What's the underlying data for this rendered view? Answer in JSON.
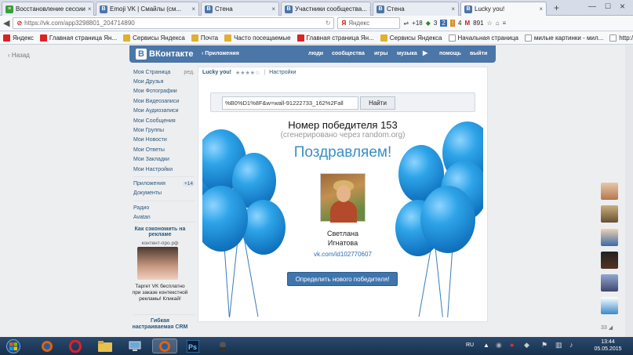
{
  "tabs": [
    {
      "label": "Восстановление сессии",
      "icon": "restore-icon",
      "active": false
    },
    {
      "label": "Emoji VK | Смайлы (см...",
      "icon": "vk-icon",
      "active": false
    },
    {
      "label": "Стена",
      "icon": "vk-icon",
      "active": false
    },
    {
      "label": "Участники сообщества...",
      "icon": "vk-icon",
      "active": false
    },
    {
      "label": "Стена",
      "icon": "vk-icon",
      "active": false
    },
    {
      "label": "Lucky you!",
      "icon": "vk-icon",
      "active": true
    }
  ],
  "address": {
    "url": "https://vk.com/app3298801_204714890",
    "search_engine": "Яндекс",
    "counters": [
      "+18",
      "3",
      "4",
      "891"
    ]
  },
  "bookmarks": [
    "Яндекс",
    "Главная страница Ян...",
    "Сервисы Яндекса",
    "Почта",
    "Часто посещаемые",
    "Главная страница Ян...",
    "Сервисы Яндекса",
    "Начальная страница",
    "милые картинки - мил...",
    "http://photoshop.vse-..."
  ],
  "back_label": "Назад",
  "vk": {
    "logo": "ВКонтакте",
    "apps_link": "Приложения",
    "nav": [
      "люди",
      "сообщества",
      "игры",
      "музыка",
      "помощь",
      "выйти"
    ]
  },
  "left_menu": [
    {
      "label": "Моя Страница",
      "extra": "ред."
    },
    {
      "label": "Мои Друзья"
    },
    {
      "label": "Мои Фотографии"
    },
    {
      "label": "Мои Видеозаписи"
    },
    {
      "label": "Мои Аудиозаписи"
    },
    {
      "label": "Мои Сообщения"
    },
    {
      "label": "Мои Группы"
    },
    {
      "label": "Мои Новости"
    },
    {
      "label": "Мои Ответы"
    },
    {
      "label": "Мои Закладки"
    },
    {
      "label": "Мои Настройки"
    }
  ],
  "left_menu2": [
    {
      "label": "Приложения",
      "badge": "+14"
    },
    {
      "label": "Документы"
    }
  ],
  "left_menu3": [
    {
      "label": "Радио"
    },
    {
      "label": "Avatan"
    }
  ],
  "ad": {
    "heading": "Как сэкономить на рекламе",
    "site": "контент-про.рф",
    "text": "Таргет VK бесплатно при заказе контекстной рекламы! Кликай!",
    "heading2": "Гибкая настраиваемая CRM"
  },
  "app": {
    "title": "Lucky you!",
    "stars": "★★★★☆",
    "settings": "Настройки",
    "search_value": "%B0%D1%8F&w=wall-91222733_162%2Fall",
    "find_button": "Найти",
    "winner_title": "Номер победителя 153",
    "generated": "(сгенерировано через random.org)",
    "congrats": "Поздравляем!",
    "winner_name_line1": "Светлана",
    "winner_name_line2": "Игнатова",
    "winner_link": "vk.com/id102770607",
    "new_winner_button": "Определить нового победителя!"
  },
  "friends_count": "33",
  "taskbar": {
    "lang": "RU",
    "time": "13:44",
    "date": "05.05.2015"
  },
  "colors": {
    "vk_blue": "#4a76a8",
    "link": "#2b587a",
    "balloon": "#1e90d8",
    "button": "#3f74ad"
  }
}
